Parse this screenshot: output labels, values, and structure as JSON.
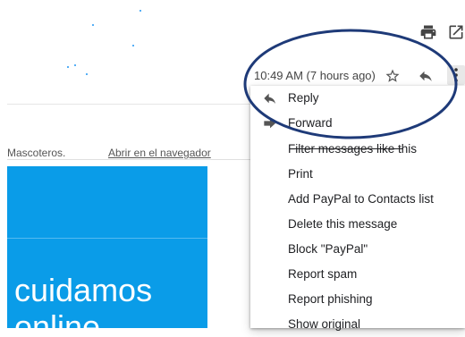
{
  "header": {
    "print_icon": "printer-icon",
    "open_icon": "open-in-new-window-icon"
  },
  "message": {
    "time": "10:49 AM (7 hours ago)",
    "star_icon": "star-outline-icon",
    "reply_icon": "reply-arrow-icon",
    "more_icon": "more-vertical-icon"
  },
  "email_body": {
    "brand_text": "Mascoteros.",
    "browser_link": "Abrir en el navegador",
    "promo_line1": "cuidamos",
    "promo_line2": "online",
    "promo_color": "#0a9ce8"
  },
  "menu": {
    "items": [
      {
        "label": "Reply",
        "icon": "reply-arrow-icon"
      },
      {
        "label": "Forward",
        "icon": "forward-arrow-icon"
      },
      {
        "label": "Filter messages like this"
      },
      {
        "label": "Print"
      },
      {
        "label": "Add PayPal to Contacts list"
      },
      {
        "label": "Delete this message"
      },
      {
        "label": "Block \"PayPal\""
      },
      {
        "label": "Report spam"
      },
      {
        "label": "Report phishing"
      },
      {
        "label": "Show original"
      }
    ]
  },
  "annotation": {
    "color": "#1e3a78"
  }
}
